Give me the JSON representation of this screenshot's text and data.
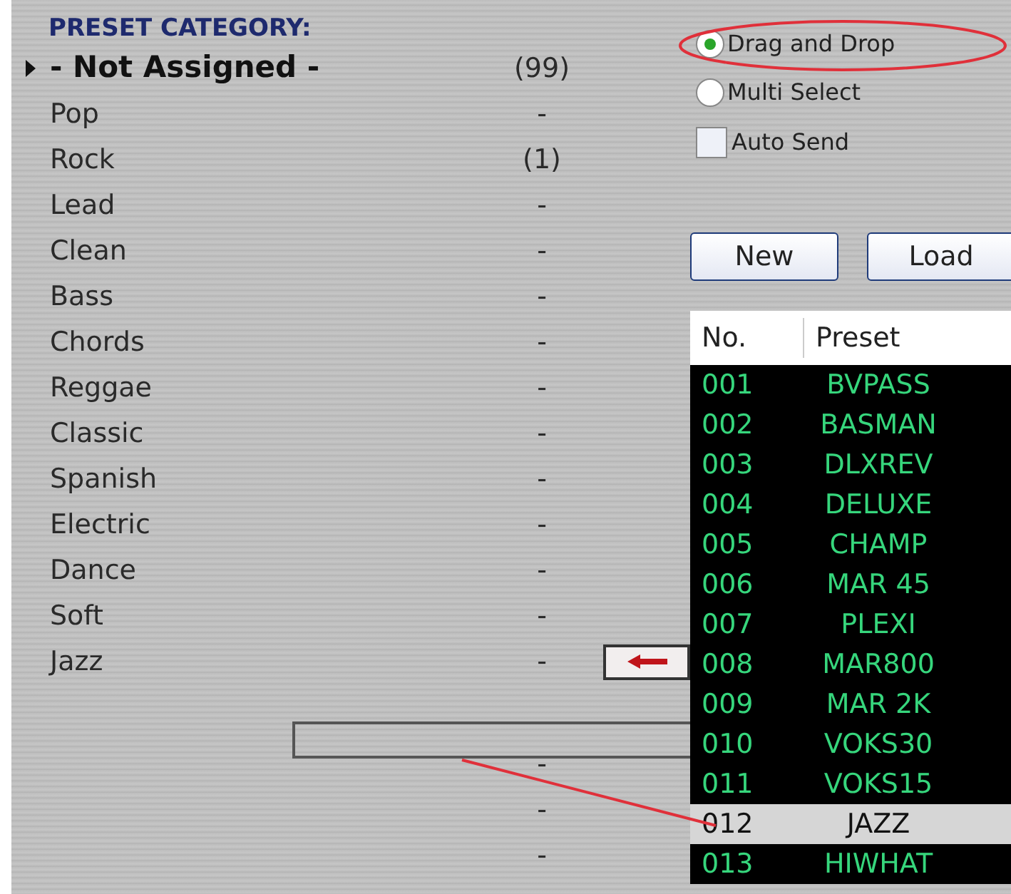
{
  "category_panel": {
    "title": "PRESET CATEGORY:",
    "items": [
      {
        "name": "- Not Assigned -",
        "count": "(99)",
        "selected": true
      },
      {
        "name": "Pop",
        "count": "-",
        "selected": false
      },
      {
        "name": "Rock",
        "count": "(1)",
        "selected": false
      },
      {
        "name": "Lead",
        "count": "-",
        "selected": false
      },
      {
        "name": "Clean",
        "count": "-",
        "selected": false
      },
      {
        "name": "Bass",
        "count": "-",
        "selected": false
      },
      {
        "name": "Chords",
        "count": "-",
        "selected": false
      },
      {
        "name": "Reggae",
        "count": "-",
        "selected": false
      },
      {
        "name": "Classic",
        "count": "-",
        "selected": false
      },
      {
        "name": "Spanish",
        "count": "-",
        "selected": false
      },
      {
        "name": "Electric",
        "count": "-",
        "selected": false
      },
      {
        "name": "Dance",
        "count": "-",
        "selected": false
      },
      {
        "name": "Soft",
        "count": "-",
        "selected": false
      },
      {
        "name": "Jazz",
        "count": "-",
        "selected": false
      }
    ],
    "unnamed_rows": [
      {
        "count": "-"
      },
      {
        "count": "-"
      },
      {
        "count": "-"
      }
    ]
  },
  "mode_options": [
    {
      "label": "Drag and Drop",
      "selected": true
    },
    {
      "label": "Multi Select",
      "selected": false
    }
  ],
  "auto_send": {
    "label": "Auto Send",
    "checked": false
  },
  "buttons": [
    "New",
    "Load"
  ],
  "preset_table": {
    "columns": [
      "No.",
      "Preset"
    ],
    "rows": [
      {
        "no": "001",
        "preset": "BVPASS",
        "selected": false
      },
      {
        "no": "002",
        "preset": "BASMAN",
        "selected": false
      },
      {
        "no": "003",
        "preset": "DLXREV",
        "selected": false
      },
      {
        "no": "004",
        "preset": "DELUXE",
        "selected": false
      },
      {
        "no": "005",
        "preset": "CHAMP",
        "selected": false
      },
      {
        "no": "006",
        "preset": "MAR 45",
        "selected": false
      },
      {
        "no": "007",
        "preset": "PLEXI",
        "selected": false
      },
      {
        "no": "008",
        "preset": "MAR800",
        "selected": false
      },
      {
        "no": "009",
        "preset": "MAR 2K",
        "selected": false
      },
      {
        "no": "010",
        "preset": "VOKS30",
        "selected": false
      },
      {
        "no": "011",
        "preset": "VOKS15",
        "selected": false
      },
      {
        "no": "012",
        "preset": "JAZZ",
        "selected": true
      },
      {
        "no": "013",
        "preset": "HIWHAT",
        "selected": false
      }
    ]
  }
}
